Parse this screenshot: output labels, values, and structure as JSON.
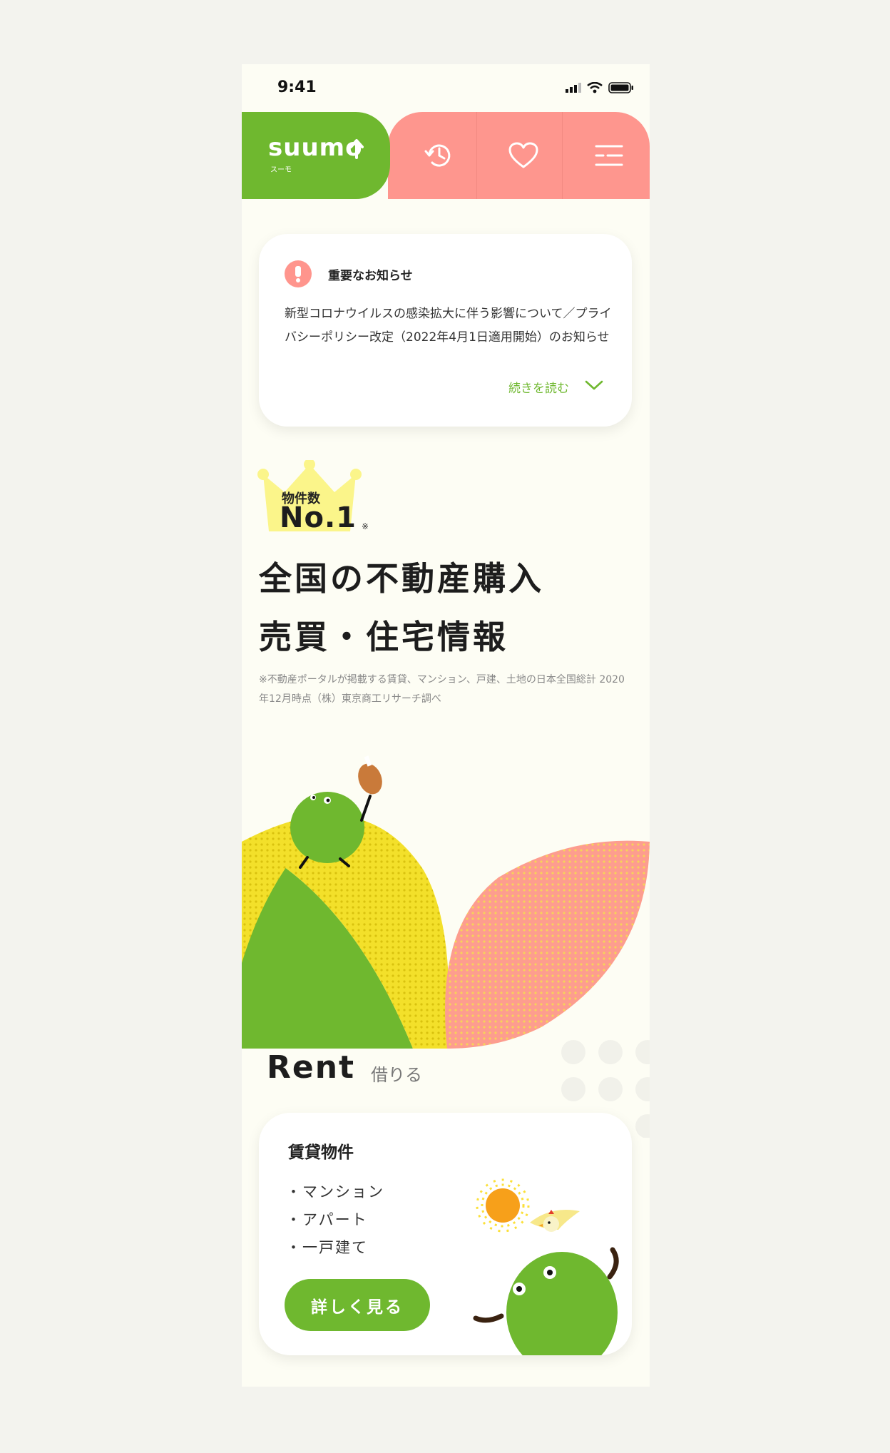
{
  "status_bar": {
    "time": "9:41"
  },
  "header": {
    "logo_text": "suumo",
    "logo_sub": "スーモ"
  },
  "notice": {
    "title": "重要なお知らせ",
    "body": "新型コロナウイルスの感染拡大に伴う影響について／プライバシーポリシー改定（2022年4月1日適用開始）のお知らせ",
    "more_label": "続きを読む"
  },
  "hero": {
    "badge_label": "物件数",
    "badge_rank": "No.1",
    "badge_mark": "※",
    "title_line1": "全国の不動産購入",
    "title_line2": "売買・住宅情報",
    "note": "※不動産ポータルが掲載する賃貸、マンション、戸建、土地の日本全国総計 2020年12月時点（株）東京商工リサーチ調べ"
  },
  "rent": {
    "title": "Rent",
    "subtitle": "借りる",
    "card": {
      "title": "賃貸物件",
      "items": [
        "・マンション",
        "・アパート",
        "・一戸建て"
      ],
      "button_label": "詳しく見る"
    }
  },
  "colors": {
    "green": "#6fb82f",
    "pink": "#fe968e",
    "yellow": "#f3e02a",
    "background": "#fdfdf4"
  }
}
